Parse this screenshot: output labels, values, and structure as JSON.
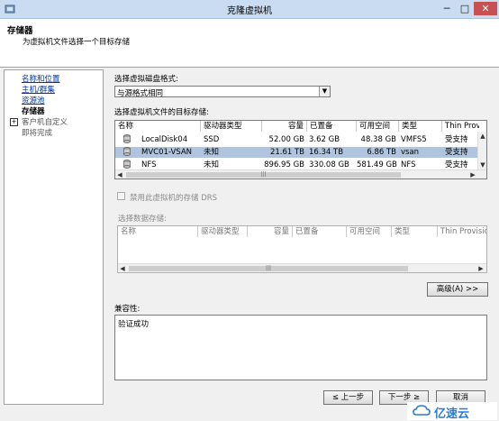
{
  "window": {
    "title": "克隆虚拟机",
    "minimize": "─",
    "maximize": "□",
    "close": "✕"
  },
  "header": {
    "title": "存储器",
    "subtitle": "为虚拟机文件选择一个目标存储"
  },
  "nav": {
    "items": [
      {
        "label": "名称和位置"
      },
      {
        "label": "主机/群集"
      },
      {
        "label": "资源池"
      },
      {
        "label": "存储器"
      },
      {
        "label": "客户机自定义"
      },
      {
        "label": "即将完成"
      }
    ],
    "expand_glyph": "+"
  },
  "disk_format": {
    "label": "选择虚拟磁盘格式:",
    "value": "与源格式相同",
    "arrow": "▼"
  },
  "target_storage": {
    "label": "选择虚拟机文件的目标存储:",
    "columns": [
      "名称",
      "驱动器类型",
      "容量",
      "已置备",
      "可用空间",
      "类型",
      "Thin Prov"
    ],
    "rows": [
      {
        "name": "LocalDisk04",
        "drive": "SSD",
        "capacity": "52.00 GB",
        "provisioned": "3.62 GB",
        "free": "48.38 GB",
        "type": "VMFS5",
        "thin": "受支持"
      },
      {
        "name": "MVC01-VSAN",
        "drive": "未知",
        "capacity": "21.61 TB",
        "provisioned": "16.34 TB",
        "free": "6.86 TB",
        "type": "vsan",
        "thin": "受支持"
      },
      {
        "name": "NFS",
        "drive": "未知",
        "capacity": "896.95 GB",
        "provisioned": "330.08 GB",
        "free": "581.49 GB",
        "type": "NFS",
        "thin": "受支持"
      }
    ],
    "selected_index": 1
  },
  "drs_checkbox": {
    "label": "禁用此虚拟机的存储 DRS",
    "checked": false
  },
  "data_storage": {
    "label": "选择数据存储:",
    "columns": [
      "名称",
      "驱动器类型",
      "容量",
      "已置备",
      "可用空间",
      "类型",
      "Thin Provisioni"
    ]
  },
  "advanced_button": {
    "label": "高级(A) >>"
  },
  "compatibility": {
    "label": "兼容性:",
    "value": "验证成功"
  },
  "footer": {
    "back": "≤ 上一步",
    "next": "下一步 ≥",
    "cancel": "取消"
  },
  "watermark": {
    "text": "亿速云"
  },
  "colors": {
    "selection": "#aec4df",
    "link": "#0033aa",
    "titlebar": "#c9dcf1"
  }
}
